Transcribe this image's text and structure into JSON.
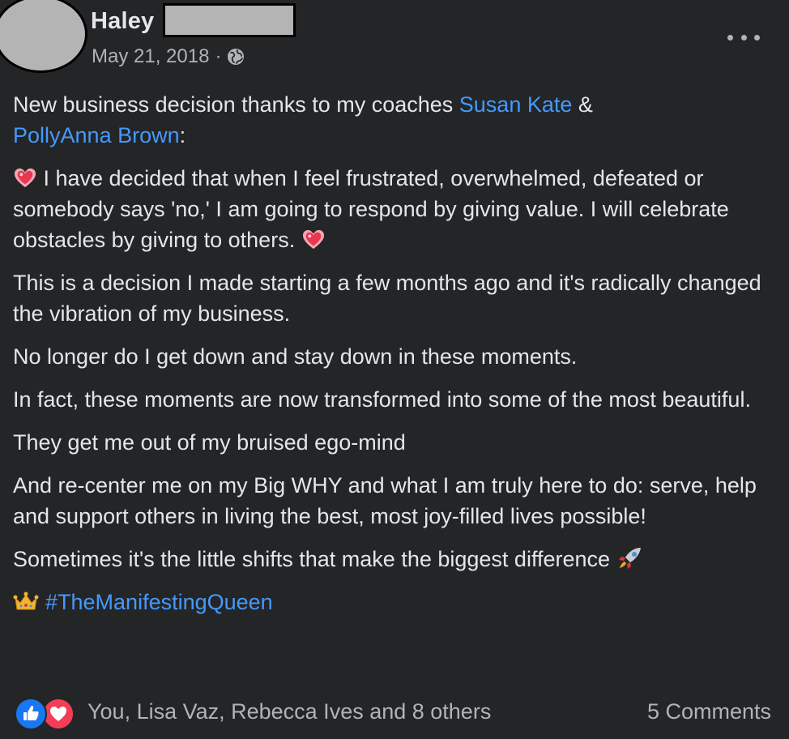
{
  "post": {
    "author": {
      "name": "Haley",
      "last_name_redacted": true
    },
    "date": "May 21, 2018",
    "separator": "·",
    "audience_icon": "globe-icon",
    "more_icon": "more-horizontal-icon"
  },
  "content": {
    "p1": {
      "text": "New business decision thanks to my coaches ",
      "mention1": "Susan Kate",
      "amp": " &",
      "mention2": "PollyAnna Brown",
      "colon": ":"
    },
    "p2": {
      "lead_icon": "sparkling-heart-icon",
      "text": " I have decided that when I feel frustrated, overwhelmed, defeated or somebody says 'no,' I am going to respond by giving value. I will celebrate obstacles by giving to others. ",
      "trail_icon": "sparkling-heart-icon"
    },
    "p3": "This is a decision I made starting a few months ago and it's radically changed the vibration of my business.",
    "p4": "No longer do I get down and stay down in these moments.",
    "p5": "In fact, these moments are now transformed into some of the most beautiful.",
    "p6": "They get me out of my bruised ego-mind",
    "p7": "And re-center me on my Big WHY and what I am truly here to do: serve, help and support others in living the best, most joy-filled lives possible!",
    "p8": {
      "text": "Sometimes it's the little shifts that make the biggest difference ",
      "icon": "rocket-icon"
    },
    "hashtag_line": {
      "icon": "crown-icon",
      "hashtag": "#TheManifestingQueen"
    }
  },
  "footer": {
    "reaction_types": [
      "like-reaction-icon",
      "love-reaction-icon"
    ],
    "reactors": "You, Lisa Vaz, Rebecca Ives and 8 others",
    "comments": "5 Comments"
  },
  "colors": {
    "background": "#242526",
    "text": "#e4e6eb",
    "secondary_text": "#b0b3b8",
    "link": "#4599ff",
    "like": "#1877f2",
    "love": "#f33e58"
  }
}
